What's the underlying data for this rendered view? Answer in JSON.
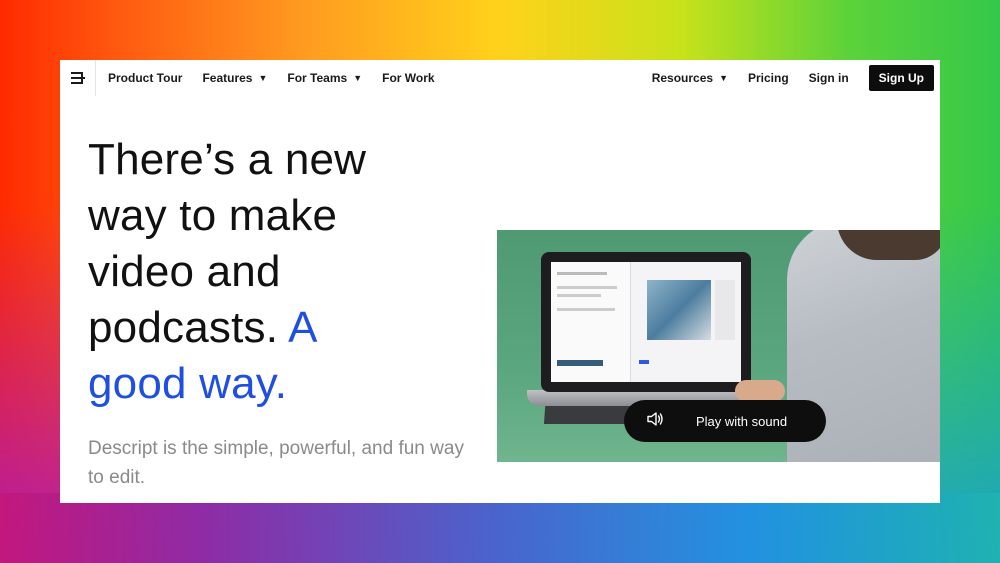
{
  "nav": {
    "product_tour": "Product Tour",
    "features": "Features",
    "for_teams": "For Teams",
    "for_work": "For Work",
    "resources": "Resources",
    "pricing": "Pricing",
    "sign_in": "Sign in",
    "sign_up": "Sign Up"
  },
  "hero": {
    "headline_line1": "There’s a new",
    "headline_line2": "way to make",
    "headline_line3": "video and",
    "headline_line4_plain": "podcasts.",
    "headline_line4_accent": "A",
    "headline_line5_accent": "good way.",
    "subtext": "Descript is the simple, powerful, and fun way to edit."
  },
  "video": {
    "play_label": "Play with sound"
  },
  "colors": {
    "accent": "#1f4fe0",
    "signup_bg": "#0d0d0d",
    "video_bg": "#5aa67e"
  },
  "icons": {
    "logo": "descript-logo-icon",
    "chevron": "chevron-down-icon",
    "speaker": "speaker-icon"
  }
}
